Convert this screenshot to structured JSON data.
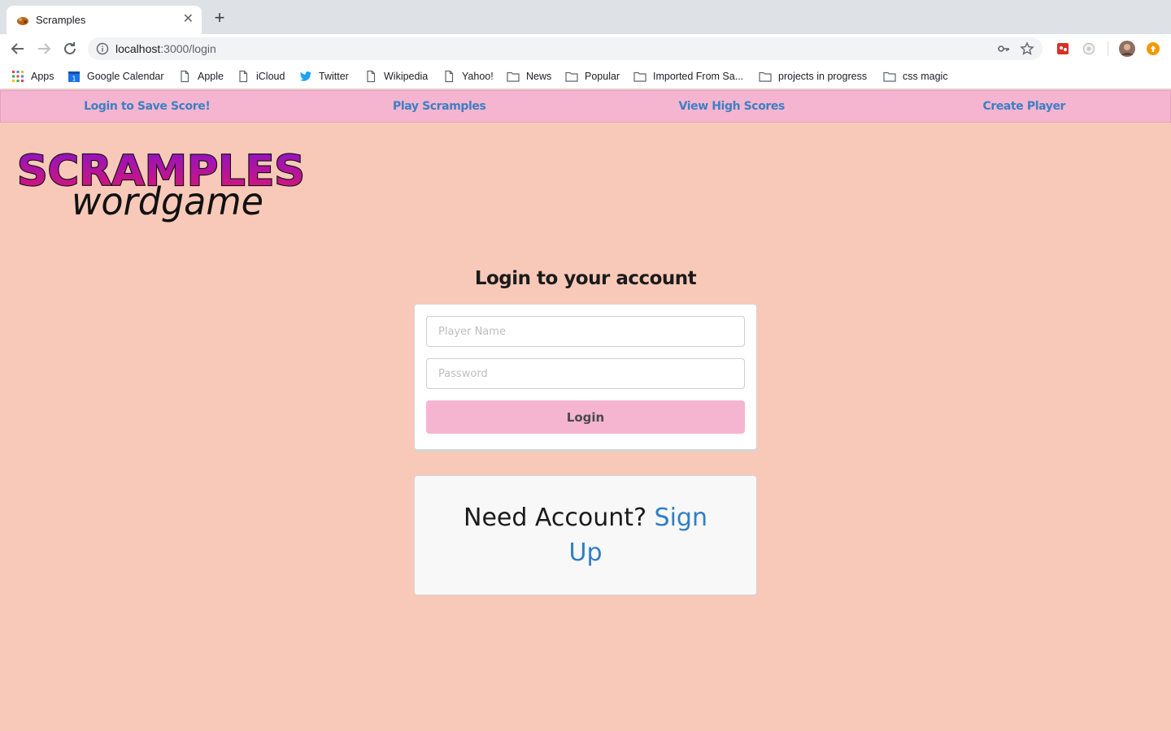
{
  "browser": {
    "tab_title": "Scramples",
    "url_host": "localhost",
    "url_rest": ":3000/login",
    "bookmarks": [
      "Apps",
      "Google Calendar",
      "Apple",
      "iCloud",
      "Twitter",
      "Wikipedia",
      "Yahoo!",
      "News",
      "Popular",
      "Imported From Sa...",
      "projects in progress",
      "css magic"
    ]
  },
  "nav": {
    "items": [
      "Login to Save Score!",
      "Play Scramples",
      "View High Scores",
      "Create Player"
    ]
  },
  "logo": {
    "line1": "SCRAMPLES",
    "line2": "wordgame"
  },
  "login": {
    "heading": "Login to your account",
    "player_placeholder": "Player Name",
    "password_placeholder": "Password",
    "button": "Login"
  },
  "signup": {
    "prompt": "Need Account?",
    "link": "Sign Up"
  },
  "colors": {
    "page_bg": "#f8c9b9",
    "nav_bg": "#f5b5d0",
    "link": "#2f7ec5"
  }
}
